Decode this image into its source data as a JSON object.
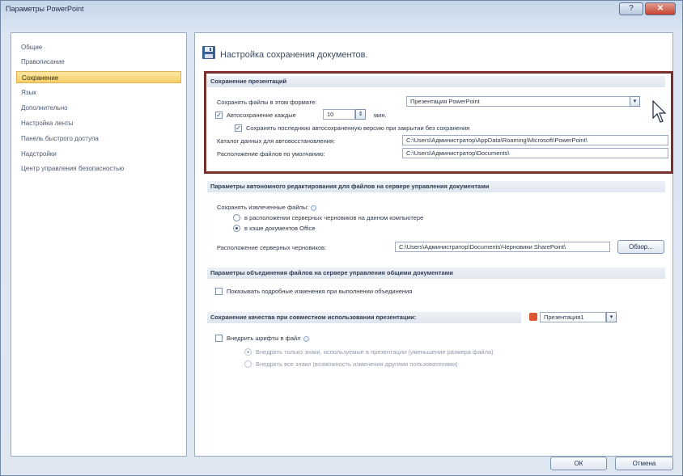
{
  "window": {
    "title": "Параметры PowerPoint",
    "help_label": "?",
    "close_label": "✕"
  },
  "sidebar": {
    "items": [
      {
        "label": "Общие"
      },
      {
        "label": "Правописание"
      },
      {
        "label": "Сохранение",
        "selected": true
      },
      {
        "label": "Язык"
      },
      {
        "label": "Дополнительно"
      },
      {
        "label": "Настройка ленты"
      },
      {
        "label": "Панель быстрого доступа"
      },
      {
        "label": "Надстройки"
      },
      {
        "label": "Центр управления безопасностью"
      }
    ]
  },
  "main": {
    "page_title": "Настройка сохранения документов.",
    "save_section": {
      "header": "Сохранение презентаций",
      "format_label": "Сохранять файлы в этом формате:",
      "format_value": "Презентация PowerPoint",
      "autosave_label": "Автосохранение каждые",
      "autosave_checked": true,
      "autosave_minutes": "10",
      "autosave_unit": "мин.",
      "keep_last_label": "Сохранять последнюю автосохраненную версию при закрытии без сохранения",
      "keep_last_checked": true,
      "autorecover_label": "Каталог данных для автовосстановления:",
      "autorecover_path": "C:\\Users\\Администратор\\AppData\\Roaming\\Microsoft\\PowerPoint\\",
      "default_location_label": "Расположение файлов по умолчанию:",
      "default_location_path": "C:\\Users\\Администратор\\Documents\\"
    },
    "offline_section": {
      "header": "Параметры автономного редактирования для файлов на сервере управления документами",
      "save_checked_out_label": "Сохранять извлеченные файлы:",
      "option_server_drafts": "в расположении серверных черновиков на данном компьютере",
      "option_office_cache": "в кэше документов Office",
      "selected_option": "office_cache",
      "drafts_location_label": "Расположение серверных черновиков:",
      "drafts_location_path": "C:\\Users\\Администратор\\Documents\\Черновики SharePoint\\",
      "browse_label": "Обзор..."
    },
    "merge_section": {
      "header": "Параметры объединения файлов на сервере управления общими документами",
      "show_changes_label": "Показывать подробные изменения при выполнении объединения",
      "show_changes_checked": false
    },
    "fidelity_section": {
      "header": "Сохранение качества при совместном использовании презентации:",
      "presentation_value": "Презентация1",
      "embed_fonts_label": "Внедрить шрифты в файл",
      "embed_fonts_checked": false,
      "option_used_chars": "Внедрять только знаки, используемые в презентации (уменьшение размера файла)",
      "option_all_chars": "Внедрять все знаки (возможность изменения другими пользователями)",
      "selected_option": "used_chars"
    }
  },
  "footer": {
    "ok_label": "ОК",
    "cancel_label": "Отмена"
  },
  "colors": {
    "highlight_border": "#7a2e2e",
    "selected_item": "#f8cf6a",
    "close_button": "#c4422d"
  }
}
